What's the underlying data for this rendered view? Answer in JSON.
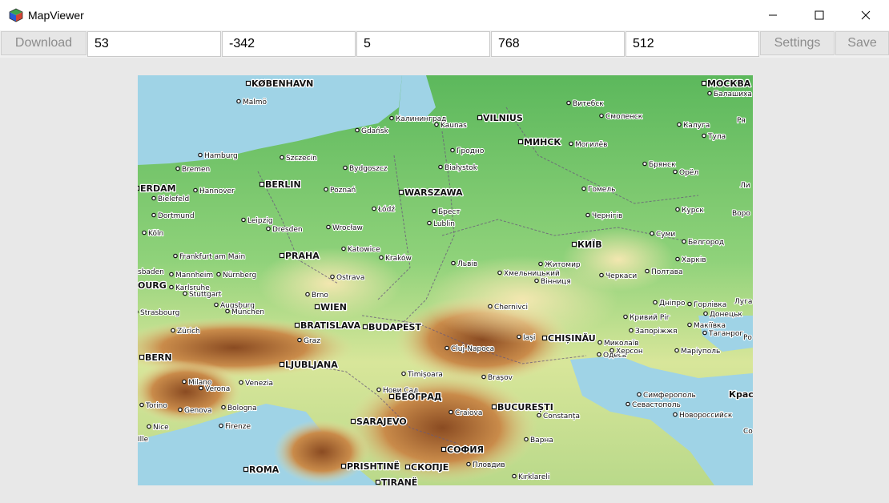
{
  "window": {
    "title": "MapViewer",
    "icons": {
      "app": "cube-app-icon",
      "minimize": "minimize-icon",
      "maximize": "maximize-icon",
      "close": "close-icon"
    }
  },
  "toolbar": {
    "download_label": "Download",
    "field_1": "53",
    "field_2": "-342",
    "field_3": "5",
    "field_4": "768",
    "field_5": "512",
    "settings_label": "Settings",
    "save_label": "Save"
  },
  "map": {
    "colors": {
      "sea": "#9fd3e6",
      "lowland": "#6cc26a",
      "hills": "#efe6a8",
      "mountains": "#9b5a2a"
    },
    "places": [
      {
        "name": "KØBENHAVN",
        "capital": true
      },
      {
        "name": "Malmö",
        "capital": false
      },
      {
        "name": "MOCKBA",
        "label": "МОСКВА",
        "capital": true
      },
      {
        "name": "Балашиха",
        "capital": false
      },
      {
        "name": "Калининград",
        "capital": false
      },
      {
        "name": "VILNIUS",
        "capital": true
      },
      {
        "name": "Kaunas",
        "capital": false
      },
      {
        "name": "Витебск",
        "capital": false
      },
      {
        "name": "Смоленск",
        "capital": false
      },
      {
        "name": "Калуга",
        "capital": false
      },
      {
        "name": "Тула",
        "capital": false
      },
      {
        "name": "Gdańsk",
        "capital": false
      },
      {
        "name": "Hamburg",
        "capital": false
      },
      {
        "name": "Szczecin",
        "capital": false
      },
      {
        "name": "Гродно",
        "capital": false
      },
      {
        "name": "МИНСК",
        "capital": true
      },
      {
        "name": "Могилёв",
        "capital": false
      },
      {
        "name": "Bremen",
        "capital": false
      },
      {
        "name": "Bydgoszcz",
        "capital": false
      },
      {
        "name": "Białystok",
        "capital": false
      },
      {
        "name": "Брянск",
        "capital": false
      },
      {
        "name": "Орёл",
        "capital": false
      },
      {
        "name": "ERDAM",
        "capital": true
      },
      {
        "name": "Hannover",
        "capital": false
      },
      {
        "name": "BERLIN",
        "capital": true
      },
      {
        "name": "Poznań",
        "capital": false
      },
      {
        "name": "WARSZAWA",
        "capital": true
      },
      {
        "name": "Гомель",
        "capital": false
      },
      {
        "name": "Bielefeld",
        "capital": false
      },
      {
        "name": "Łódź",
        "capital": false
      },
      {
        "name": "Брест",
        "capital": false
      },
      {
        "name": "Dortmund",
        "capital": false
      },
      {
        "name": "Leipzig",
        "capital": false
      },
      {
        "name": "Lublin",
        "capital": false
      },
      {
        "name": "Чернігів",
        "capital": false
      },
      {
        "name": "Курск",
        "capital": false
      },
      {
        "name": "Köln",
        "capital": false
      },
      {
        "name": "Dresden",
        "capital": false
      },
      {
        "name": "Wrocław",
        "capital": false
      },
      {
        "name": "Суми",
        "capital": false
      },
      {
        "name": "КИЇВ",
        "capital": true
      },
      {
        "name": "Белгород",
        "capital": false
      },
      {
        "name": "Frankfurt am Main",
        "capital": false
      },
      {
        "name": "PRAHA",
        "capital": true
      },
      {
        "name": "Katowice",
        "capital": false
      },
      {
        "name": "Kraków",
        "capital": false
      },
      {
        "name": "Львів",
        "capital": false
      },
      {
        "name": "Житомир",
        "capital": false
      },
      {
        "name": "Харків",
        "capital": false
      },
      {
        "name": "Mannheim",
        "capital": false
      },
      {
        "name": "Nürnberg",
        "capital": false
      },
      {
        "name": "Ostrava",
        "capital": false
      },
      {
        "name": "Хмельницький",
        "capital": false
      },
      {
        "name": "Черкаси",
        "capital": false
      },
      {
        "name": "Полтава",
        "capital": false
      },
      {
        "name": "Вінниця",
        "capital": false
      },
      {
        "name": "Karlsruhe",
        "capital": false
      },
      {
        "name": "Stuttgart",
        "capital": false
      },
      {
        "name": "Brno",
        "capital": false
      },
      {
        "name": "Augsburg",
        "capital": false
      },
      {
        "name": "München",
        "capital": false
      },
      {
        "name": "WIEN",
        "capital": true
      },
      {
        "name": "Chernivtsi",
        "label": "Chernivci",
        "capital": false
      },
      {
        "name": "Дніпро",
        "capital": false
      },
      {
        "name": "Горлівка",
        "capital": false
      },
      {
        "name": "Strasbourg",
        "capital": false
      },
      {
        "name": "BRATISLAVA",
        "capital": true
      },
      {
        "name": "BUDAPEST",
        "capital": true
      },
      {
        "name": "Кривий Ріг",
        "capital": false
      },
      {
        "name": "Донецьк",
        "capital": false
      },
      {
        "name": "Zürich",
        "capital": false
      },
      {
        "name": "Запоріжжя",
        "capital": false
      },
      {
        "name": "Макіївка",
        "capital": false
      },
      {
        "name": "Graz",
        "capital": false
      },
      {
        "name": "Cluj-Napoca",
        "capital": false
      },
      {
        "name": "Iași",
        "capital": false
      },
      {
        "name": "CHIȘINĂU",
        "capital": true
      },
      {
        "name": "Миколаїв",
        "capital": false
      },
      {
        "name": "Таганрог",
        "capital": false
      },
      {
        "name": "BERN",
        "capital": true
      },
      {
        "name": "Одеса",
        "capital": false
      },
      {
        "name": "Херсон",
        "capital": false
      },
      {
        "name": "Маріуполь",
        "capital": false
      },
      {
        "name": "LJUBLJANA",
        "capital": true
      },
      {
        "name": "Timișoara",
        "capital": false
      },
      {
        "name": "Brașov",
        "capital": false
      },
      {
        "name": "Milano",
        "capital": false
      },
      {
        "name": "Verona",
        "capital": false
      },
      {
        "name": "Venezia",
        "capital": false
      },
      {
        "name": "Нови Сад",
        "capital": false
      },
      {
        "name": "БЕОГРАД",
        "capital": true
      },
      {
        "name": "BUCUREȘTI",
        "capital": true
      },
      {
        "name": "Симферополь",
        "capital": false
      },
      {
        "name": "Torino",
        "capital": false
      },
      {
        "name": "Genova",
        "capital": false
      },
      {
        "name": "Bologna",
        "capital": false
      },
      {
        "name": "Craiova",
        "capital": false
      },
      {
        "name": "Constanța",
        "capital": false
      },
      {
        "name": "Севастополь",
        "capital": false
      },
      {
        "name": "Новороссийск",
        "capital": false
      },
      {
        "name": "SARAJEVO",
        "capital": true
      },
      {
        "name": "Nice",
        "capital": false
      },
      {
        "name": "Firenze",
        "capital": false
      },
      {
        "name": "СОФИЯ",
        "capital": true
      },
      {
        "name": "Варна",
        "capital": false
      },
      {
        "name": "ROMA",
        "capital": true
      },
      {
        "name": "PRISHTINË",
        "capital": true
      },
      {
        "name": "СКОПЈЕ",
        "capital": true
      },
      {
        "name": "Пловдив",
        "capital": false
      },
      {
        "name": "Kırklareli",
        "capital": false
      },
      {
        "name": "TIRANË",
        "capital": true
      }
    ],
    "partial_labels": [
      "Ря",
      "Ли",
      "Воро",
      "Луга",
      "Ро",
      "Крас",
      "Со",
      "sbaden",
      "OURG",
      "Ille"
    ]
  }
}
